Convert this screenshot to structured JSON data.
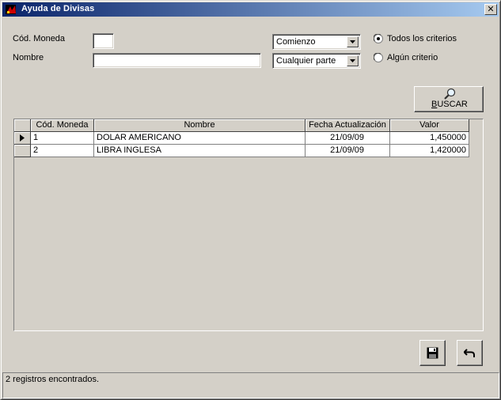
{
  "window": {
    "title": "Ayuda de Divisas",
    "close_glyph": "✕"
  },
  "filters": {
    "codigo_label": "Cód. Moneda",
    "codigo_value": "",
    "nombre_label": "Nombre",
    "nombre_value": "",
    "match_start_selected": "Comienzo",
    "match_anywhere_selected": "Cualquier parte",
    "radio_all": "Todos los criterios",
    "radio_any": "Algún criterio",
    "radio_all_checked": true
  },
  "search_button": {
    "label_prefix": "",
    "label_underlined": "B",
    "label_rest": "USCAR",
    "icon": "magnifier-icon"
  },
  "table": {
    "columns": [
      "Cód. Moneda",
      "Nombre",
      "Fecha Actualización",
      "Valor"
    ],
    "rows": [
      {
        "codigo": "1",
        "nombre": "DOLAR AMERICANO",
        "fecha": "21/09/09",
        "valor": "1,450000"
      },
      {
        "codigo": "2",
        "nombre": "LIBRA INGLESA",
        "fecha": "21/09/09",
        "valor": "1,420000"
      }
    ],
    "current_row_indicator": "row-pointer-icon"
  },
  "actions": {
    "save_icon": "floppy-disk-icon",
    "undo_icon": "undo-arrow-icon"
  },
  "status": {
    "text": "2 registros encontrados."
  },
  "colors": {
    "title_start": "#0a246a",
    "title_end": "#a6caf0",
    "face": "#d4d0c8"
  }
}
